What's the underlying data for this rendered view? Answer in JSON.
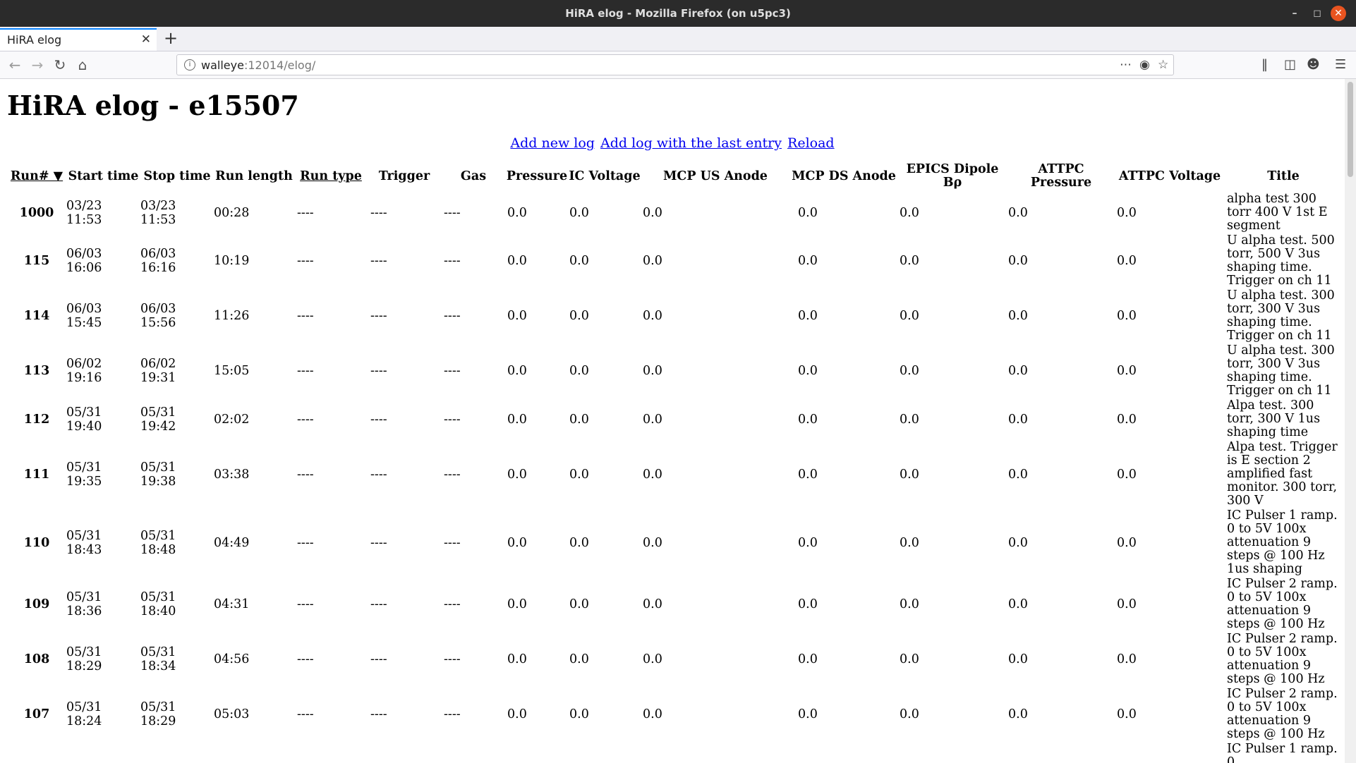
{
  "window": {
    "title": "HiRA elog - Mozilla Firefox (on u5pc3)"
  },
  "tab": {
    "label": "HiRA elog"
  },
  "urlbar": {
    "host": "walleye",
    "rest": ":12014/elog/"
  },
  "page": {
    "heading": "HiRA elog - e15507",
    "links": [
      "Add new log",
      "Add log with the last entry",
      "Reload"
    ]
  },
  "table": {
    "headers": [
      "Run# ▼",
      "Start time",
      "Stop time",
      "Run length",
      "Run type",
      "Trigger",
      "Gas",
      "Pressure",
      "IC Voltage",
      "MCP US Anode",
      "MCP DS Anode",
      "EPICS Dipole Bρ",
      "ATTPC Pressure",
      "ATTPC Voltage",
      "Title"
    ],
    "rows": [
      {
        "run": "1000",
        "start": "03/23 11:53",
        "stop": "03/23 11:53",
        "len": "00:28",
        "type": "----",
        "trig": "----",
        "gas": "----",
        "p": "0.0",
        "icv": "0.0",
        "mus": "0.0",
        "mds": "0.0",
        "dip": "0.0",
        "ap": "0.0",
        "av": "0.0",
        "title": "alpha test 300 torr 400 V 1st E segment"
      },
      {
        "run": "115",
        "start": "06/03 16:06",
        "stop": "06/03 16:16",
        "len": "10:19",
        "type": "----",
        "trig": "----",
        "gas": "----",
        "p": "0.0",
        "icv": "0.0",
        "mus": "0.0",
        "mds": "0.0",
        "dip": "0.0",
        "ap": "0.0",
        "av": "0.0",
        "title": "U alpha test. 500 torr, 500 V 3us shaping time. Trigger on ch 11"
      },
      {
        "run": "114",
        "start": "06/03 15:45",
        "stop": "06/03 15:56",
        "len": "11:26",
        "type": "----",
        "trig": "----",
        "gas": "----",
        "p": "0.0",
        "icv": "0.0",
        "mus": "0.0",
        "mds": "0.0",
        "dip": "0.0",
        "ap": "0.0",
        "av": "0.0",
        "title": "U alpha test. 300 torr, 300 V 3us shaping time. Trigger on ch 11"
      },
      {
        "run": "113",
        "start": "06/02 19:16",
        "stop": "06/02 19:31",
        "len": "15:05",
        "type": "----",
        "trig": "----",
        "gas": "----",
        "p": "0.0",
        "icv": "0.0",
        "mus": "0.0",
        "mds": "0.0",
        "dip": "0.0",
        "ap": "0.0",
        "av": "0.0",
        "title": "U alpha test. 300 torr, 300 V 3us shaping time. Trigger on ch 11"
      },
      {
        "run": "112",
        "start": "05/31 19:40",
        "stop": "05/31 19:42",
        "len": "02:02",
        "type": "----",
        "trig": "----",
        "gas": "----",
        "p": "0.0",
        "icv": "0.0",
        "mus": "0.0",
        "mds": "0.0",
        "dip": "0.0",
        "ap": "0.0",
        "av": "0.0",
        "title": "Alpa test. 300 torr, 300 V 1us shaping time"
      },
      {
        "run": "111",
        "start": "05/31 19:35",
        "stop": "05/31 19:38",
        "len": "03:38",
        "type": "----",
        "trig": "----",
        "gas": "----",
        "p": "0.0",
        "icv": "0.0",
        "mus": "0.0",
        "mds": "0.0",
        "dip": "0.0",
        "ap": "0.0",
        "av": "0.0",
        "title": "Alpa test. Trigger is E section 2 amplified fast monitor. 300 torr, 300 V"
      },
      {
        "run": "110",
        "start": "05/31 18:43",
        "stop": "05/31 18:48",
        "len": "04:49",
        "type": "----",
        "trig": "----",
        "gas": "----",
        "p": "0.0",
        "icv": "0.0",
        "mus": "0.0",
        "mds": "0.0",
        "dip": "0.0",
        "ap": "0.0",
        "av": "0.0",
        "title": "IC Pulser 1 ramp. 0 to 5V 100x attenuation 9 steps @ 100 Hz 1us shaping"
      },
      {
        "run": "109",
        "start": "05/31 18:36",
        "stop": "05/31 18:40",
        "len": "04:31",
        "type": "----",
        "trig": "----",
        "gas": "----",
        "p": "0.0",
        "icv": "0.0",
        "mus": "0.0",
        "mds": "0.0",
        "dip": "0.0",
        "ap": "0.0",
        "av": "0.0",
        "title": "IC Pulser 2 ramp. 0 to 5V 100x attenuation 9 steps @ 100 Hz"
      },
      {
        "run": "108",
        "start": "05/31 18:29",
        "stop": "05/31 18:34",
        "len": "04:56",
        "type": "----",
        "trig": "----",
        "gas": "----",
        "p": "0.0",
        "icv": "0.0",
        "mus": "0.0",
        "mds": "0.0",
        "dip": "0.0",
        "ap": "0.0",
        "av": "0.0",
        "title": "IC Pulser 2 ramp. 0 to 5V 100x attenuation 9 steps @ 100 Hz"
      },
      {
        "run": "107",
        "start": "05/31 18:24",
        "stop": "05/31 18:29",
        "len": "05:03",
        "type": "----",
        "trig": "----",
        "gas": "----",
        "p": "0.0",
        "icv": "0.0",
        "mus": "0.0",
        "mds": "0.0",
        "dip": "0.0",
        "ap": "0.0",
        "av": "0.0",
        "title": "IC Pulser 2 ramp. 0 to 5V 100x attenuation 9 steps @ 100 Hz"
      },
      {
        "run": "",
        "start": "",
        "stop": "",
        "len": "",
        "type": "",
        "trig": "",
        "gas": "",
        "p": "",
        "icv": "",
        "mus": "",
        "mds": "",
        "dip": "",
        "ap": "",
        "av": "",
        "title": "IC Pulser 1 ramp. 0"
      }
    ]
  }
}
